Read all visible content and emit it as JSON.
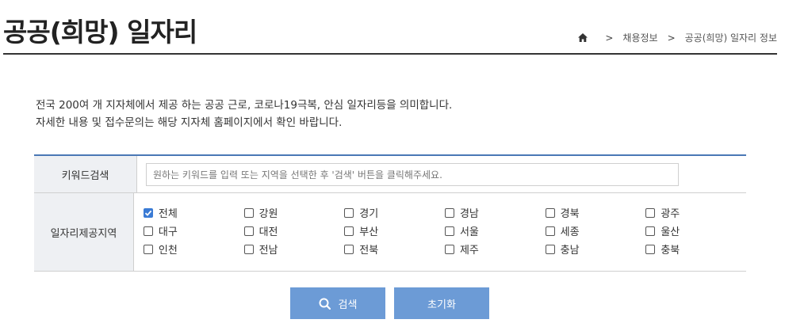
{
  "header": {
    "title": "공공(희망) 일자리",
    "breadcrumb": [
      "채용정보",
      "공공(희망) 일자리 정보"
    ],
    "breadcrumb_sep": ">"
  },
  "intro": {
    "line1": "전국 200여 개 지자체에서 제공 하는 공공 근로, 코로나19극복, 안심 일자리등을 의미합니다.",
    "line2": "자세한 내용 및 접수문의는 해당 지자체 홈페이지에서 확인 바랍니다."
  },
  "search": {
    "keyword_label": "키워드검색",
    "keyword_placeholder": "원하는 키워드를 입력 또는 지역을 선택한 후 '검색' 버튼을 클릭해주세요.",
    "keyword_value": "",
    "region_label": "일자리제공지역",
    "regions": [
      {
        "label": "전체",
        "checked": true
      },
      {
        "label": "강원",
        "checked": false
      },
      {
        "label": "경기",
        "checked": false
      },
      {
        "label": "경남",
        "checked": false
      },
      {
        "label": "경북",
        "checked": false
      },
      {
        "label": "광주",
        "checked": false
      },
      {
        "label": "대구",
        "checked": false
      },
      {
        "label": "대전",
        "checked": false
      },
      {
        "label": "부산",
        "checked": false
      },
      {
        "label": "서울",
        "checked": false
      },
      {
        "label": "세종",
        "checked": false
      },
      {
        "label": "울산",
        "checked": false
      },
      {
        "label": "인천",
        "checked": false
      },
      {
        "label": "전남",
        "checked": false
      },
      {
        "label": "전북",
        "checked": false
      },
      {
        "label": "제주",
        "checked": false
      },
      {
        "label": "충남",
        "checked": false
      },
      {
        "label": "충북",
        "checked": false
      }
    ]
  },
  "buttons": {
    "search_label": "검색",
    "reset_label": "초기화"
  },
  "colors": {
    "accent": "#6c9bd6",
    "table_border": "#4a78b5",
    "checkbox_checked": "#3a7bd5",
    "header_cell_bg": "#eef0f3"
  },
  "icons": {
    "home": "home-icon",
    "search": "magnifier-icon",
    "check": "checkmark-icon"
  }
}
